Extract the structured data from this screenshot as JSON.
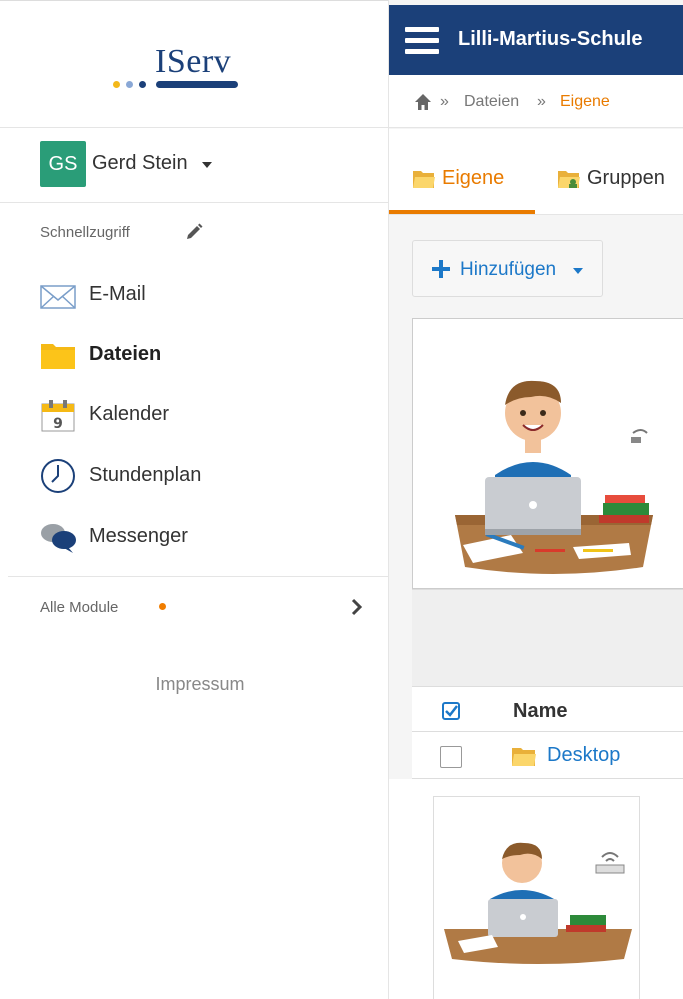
{
  "logo": {
    "text": "IServ",
    "dot_colors": [
      "#f3b81a",
      "#8aa8d6",
      "#1b4079"
    ]
  },
  "user": {
    "initials": "GS",
    "name": "Gerd Stein",
    "avatar_color": "#2a9d78"
  },
  "sidebar": {
    "quick_access_label": "Schnellzugriff",
    "items": [
      {
        "label": "E-Mail",
        "icon": "envelope-icon"
      },
      {
        "label": "Dateien",
        "icon": "folder-icon",
        "active": true
      },
      {
        "label": "Kalender",
        "icon": "calendar-icon",
        "calendar_day": "9"
      },
      {
        "label": "Stundenplan",
        "icon": "clock-icon"
      },
      {
        "label": "Messenger",
        "icon": "chat-bubbles-icon"
      }
    ],
    "all_modules_label": "Alle Module",
    "impressum_label": "Impressum"
  },
  "header": {
    "school_name": "Lilli-Martius-Schule"
  },
  "breadcrumb": {
    "items": [
      "Dateien",
      "Eigene"
    ],
    "separator": "»"
  },
  "tabs": [
    {
      "label": "Eigene",
      "active": true
    },
    {
      "label": "Gruppen",
      "active": false
    }
  ],
  "toolbar": {
    "add_label": "Hinzufügen"
  },
  "file_list": {
    "column_name": "Name",
    "rows": [
      {
        "name": "Desktop",
        "type": "folder"
      }
    ]
  },
  "colors": {
    "brand": "#1b4079",
    "accent_orange": "#e97b00",
    "link_blue": "#1c78c8"
  }
}
